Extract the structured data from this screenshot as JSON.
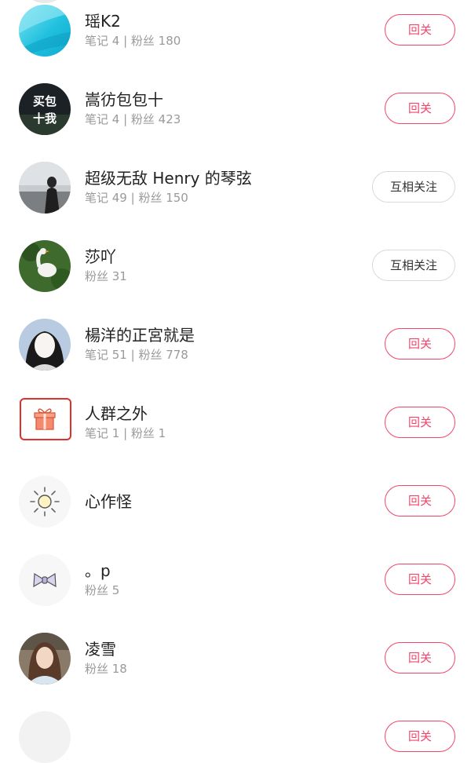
{
  "follow_label": "回关",
  "mutual_label": "互相关注",
  "users": [
    {
      "name": "瑶K2",
      "meta": "笔记 4 | 粉丝 180",
      "button": "回关"
    },
    {
      "name": "嵩彷包包十",
      "meta": "笔记 4 | 粉丝 423",
      "button": "回关",
      "avatar_text": [
        "买包",
        "十我"
      ]
    },
    {
      "name": "超级无敌 Henry 的琴弦",
      "meta": "笔记 49 | 粉丝 150",
      "button": "互相关注"
    },
    {
      "name": "莎吖",
      "meta": "粉丝 31",
      "button": "互相关注"
    },
    {
      "name": "楊洋的正宮就是",
      "meta": "笔记 51 | 粉丝 778",
      "button": "回关"
    },
    {
      "name": "人群之外",
      "meta": "笔记 1 | 粉丝 1",
      "button": "回关"
    },
    {
      "name": "心作怪",
      "meta": "",
      "button": "回关"
    },
    {
      "name": "。p",
      "meta": "粉丝 5",
      "button": "回关"
    },
    {
      "name": "凌雪",
      "meta": "粉丝 18",
      "button": "回关"
    }
  ],
  "colors": {
    "accent": "#f0466a",
    "highlight_box": "#e0302a",
    "meta_text": "#9a9a9a"
  }
}
